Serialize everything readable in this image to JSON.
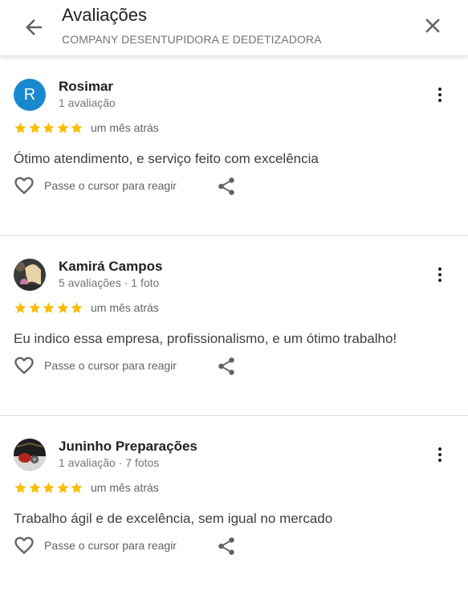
{
  "header": {
    "title": "Avaliações",
    "subtitle": "COMPANY DESENTUPIDORA E DEDETIZADORA"
  },
  "colors": {
    "star": "#fbbc04",
    "avatar_letter_bg": "#1a88cf",
    "text_secondary": "#70757a"
  },
  "icons": [
    "arrow-back-icon",
    "close-icon",
    "more-vert-icon",
    "star-icon",
    "heart-outline-icon",
    "share-icon"
  ],
  "reviews": [
    {
      "author": "Rosimar",
      "avatar_letter": "R",
      "meta": "1 avaliação",
      "rating": 5,
      "time": "um mês atrás",
      "text": "Ótimo atendimento, e serviço feito com excelência",
      "react_label": "Passe o cursor para reagir"
    },
    {
      "author": "Kamirá Campos",
      "avatar_letter": "",
      "meta": "5 avaliações · 1 foto",
      "rating": 5,
      "time": "um mês atrás",
      "text": "Eu indico essa empresa, profissionalismo, e um ótimo trabalho!",
      "react_label": "Passe o cursor para reagir"
    },
    {
      "author": "Juninho Preparações",
      "avatar_letter": "",
      "meta": "1 avaliação · 7 fotos",
      "rating": 5,
      "time": "um mês atrás",
      "text": "Trabalho ágil e de excelência, sem igual no mercado",
      "react_label": "Passe o cursor para reagir"
    }
  ]
}
